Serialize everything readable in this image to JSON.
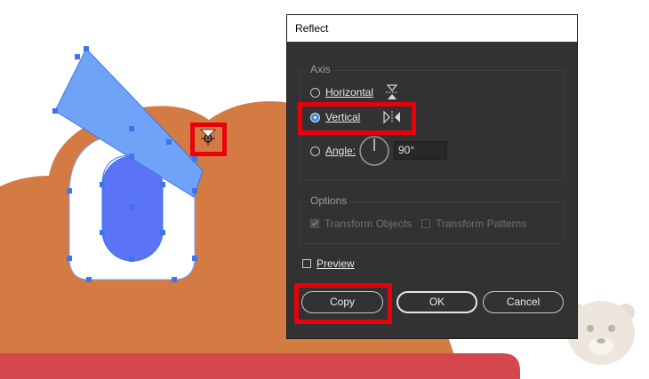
{
  "dialog": {
    "title": "Reflect",
    "axis": {
      "title": "Axis",
      "horizontal_label": "Horizontal",
      "vertical_label": "Vertical",
      "angle_label": "Angle:",
      "angle_value": "90°",
      "selected": "vertical"
    },
    "options": {
      "title": "Options",
      "transform_objects_label": "Transform Objects",
      "transform_patterns_label": "Transform Patterns",
      "transform_objects_checked": true,
      "transform_patterns_checked": false
    },
    "preview_label": "Preview",
    "preview_checked": false,
    "buttons": {
      "copy": "Copy",
      "ok": "OK",
      "cancel": "Cancel"
    }
  },
  "colors": {
    "dialog_bg": "#323232",
    "highlight": "#e8000b",
    "artwork_orange": "#d47a43",
    "artwork_red": "#d4474d",
    "artwork_blue": "#6ea3f7",
    "artwork_inner_blue": "#5a74f5",
    "selection_blue": "#3f73e8"
  },
  "icons": {
    "reflect_horizontal": "reflect-horizontal-icon",
    "reflect_vertical": "reflect-vertical-icon",
    "angle_dial": "angle-dial-icon",
    "reflect_origin": "reflect-origin-icon",
    "watermark": "bear-watermark-icon"
  }
}
